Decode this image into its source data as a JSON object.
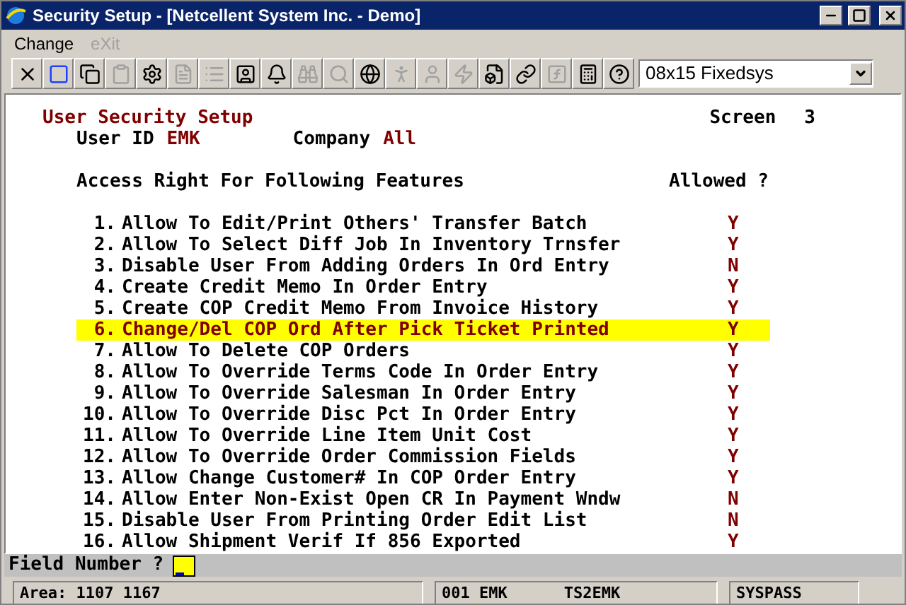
{
  "window": {
    "title": "Security Setup - [Netcellent System Inc. - Demo]"
  },
  "menu": [
    {
      "label": "Change",
      "disabled": false
    },
    {
      "label": "eXit",
      "disabled": true
    }
  ],
  "toolbar": [
    {
      "disabled": false
    },
    {
      "disabled": false
    },
    {
      "disabled": false
    },
    {
      "disabled": true
    },
    {
      "disabled": false
    },
    {
      "disabled": true
    },
    {
      "disabled": true
    },
    {
      "disabled": false
    },
    {
      "disabled": false
    },
    {
      "disabled": true
    },
    {
      "disabled": true
    },
    {
      "disabled": false
    },
    {
      "disabled": true
    },
    {
      "disabled": true
    },
    {
      "disabled": true
    },
    {
      "disabled": false
    },
    {
      "disabled": false
    },
    {
      "disabled": true
    },
    {
      "disabled": false
    },
    {
      "disabled": false
    }
  ],
  "font_select": {
    "value": "08x15 Fixedsys"
  },
  "screen": {
    "title": "User Security Setup",
    "screen_label": "Screen",
    "screen_number": "3",
    "user_id_label": "User ID",
    "user_id": "EMK",
    "company_label": "Company",
    "company": "All",
    "header": "Access Right For Following Features",
    "allowed_header": "Allowed ?",
    "items": [
      {
        "number": "1.",
        "text": "Allow To Edit/Print Others' Transfer Batch",
        "allowed": "Y",
        "selected": false
      },
      {
        "number": "2.",
        "text": "Allow To Select Diff Job In Inventory Trnsfer",
        "allowed": "Y",
        "selected": false
      },
      {
        "number": "3.",
        "text": "Disable User From Adding Orders In Ord Entry",
        "allowed": "N",
        "selected": false
      },
      {
        "number": "4.",
        "text": "Create Credit Memo In Order Entry",
        "allowed": "Y",
        "selected": false
      },
      {
        "number": "5.",
        "text": "Create COP Credit Memo From Invoice History",
        "allowed": "Y",
        "selected": false
      },
      {
        "number": "6.",
        "text": "Change/Del COP Ord After Pick Ticket Printed",
        "allowed": "Y",
        "selected": true
      },
      {
        "number": "7.",
        "text": "Allow To Delete COP Orders",
        "allowed": "Y",
        "selected": false
      },
      {
        "number": "8.",
        "text": "Allow To Override Terms Code In Order Entry",
        "allowed": "Y",
        "selected": false
      },
      {
        "number": "9.",
        "text": "Allow To Override Salesman In Order Entry",
        "allowed": "Y",
        "selected": false
      },
      {
        "number": "10.",
        "text": "Allow To Override Disc Pct In Order Entry",
        "allowed": "Y",
        "selected": false
      },
      {
        "number": "11.",
        "text": "Allow To Override Line Item Unit Cost",
        "allowed": "Y",
        "selected": false
      },
      {
        "number": "12.",
        "text": "Allow To Override Order Commission Fields",
        "allowed": "Y",
        "selected": false
      },
      {
        "number": "13.",
        "text": "Allow Change Customer# In COP Order Entry",
        "allowed": "Y",
        "selected": false
      },
      {
        "number": "14.",
        "text": "Allow Enter Non-Exist Open CR In Payment Wndw",
        "allowed": "N",
        "selected": false
      },
      {
        "number": "15.",
        "text": "Disable User From Printing Order Edit List",
        "allowed": "N",
        "selected": false
      },
      {
        "number": "16.",
        "text": "Allow Shipment Verif If 856 Exported",
        "allowed": "Y",
        "selected": false
      }
    ]
  },
  "prompt": {
    "label": "Field Number ?"
  },
  "status_bar": [
    {
      "texts": [
        "Area: 1107 1167"
      ]
    },
    {
      "texts": [
        "001 EMK",
        "TS2EMK"
      ]
    },
    {
      "texts": [
        "SYSPASS"
      ]
    }
  ]
}
